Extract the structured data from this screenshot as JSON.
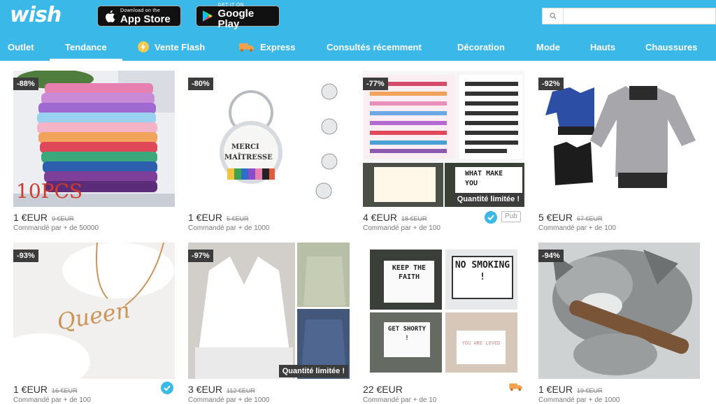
{
  "header": {
    "logo": "wish",
    "app_store": {
      "small": "Download on the",
      "big": "App Store"
    },
    "google_play": {
      "small": "GET IT ON",
      "big": "Google Play"
    },
    "search": {
      "placeholder": "",
      "value": ""
    }
  },
  "nav": {
    "items": [
      {
        "label": "Outlet"
      },
      {
        "label": "Tendance"
      },
      {
        "label": "Vente Flash"
      },
      {
        "label": "Express"
      },
      {
        "label": "Consultés récemment"
      },
      {
        "label": "Décoration"
      },
      {
        "label": "Mode"
      },
      {
        "label": "Hauts"
      },
      {
        "label": "Chaussures"
      }
    ],
    "active": "Tendance"
  },
  "colors": {
    "brand": "#3ab8e8",
    "badge": "#3c3c3c"
  },
  "products": [
    {
      "discount": "-88%",
      "price": "1 €EUR",
      "old_price": "9 €EUR",
      "ordered": "Commandé par + de 50000",
      "image_text": "10PCS"
    },
    {
      "discount": "-80%",
      "price": "1 €EUR",
      "old_price": "5 €EUR",
      "ordered": "Commandé par + de 1000",
      "image_text_1": "MERCI",
      "image_text_2": "MAÎTRESSE"
    },
    {
      "discount": "-77%",
      "price": "4 €EUR",
      "old_price": "18 €EUR",
      "ordered": "Commandé par + de 100",
      "limited": "Quantité limitée !",
      "pub": "Pub",
      "image_text": "WHAT MAKE YOU"
    },
    {
      "discount": "-92%",
      "price": "5 €EUR",
      "old_price": "67 €EUR",
      "ordered": "Commandé par + de 100"
    },
    {
      "discount": "-93%",
      "price": "1 €EUR",
      "old_price": "16 €EUR",
      "ordered": "Commandé par + de 100",
      "image_text": "Queen"
    },
    {
      "discount": "-97%",
      "price": "3 €EUR",
      "old_price": "112 €EUR",
      "ordered": "Commandé par + de 1000",
      "limited": "Quantité limitée !"
    },
    {
      "discount": "",
      "price": "22 €EUR",
      "old_price": "",
      "ordered": "Commandé par + de 10",
      "lightbox_texts": [
        "KEEP THE FAITH",
        "NO SMOKING !",
        "GET SHORTY !",
        "YOU ARE LOVED"
      ]
    },
    {
      "discount": "-94%",
      "price": "1 €EUR",
      "old_price": "19 €EUR",
      "ordered": "Commandé par + de 1000"
    }
  ]
}
